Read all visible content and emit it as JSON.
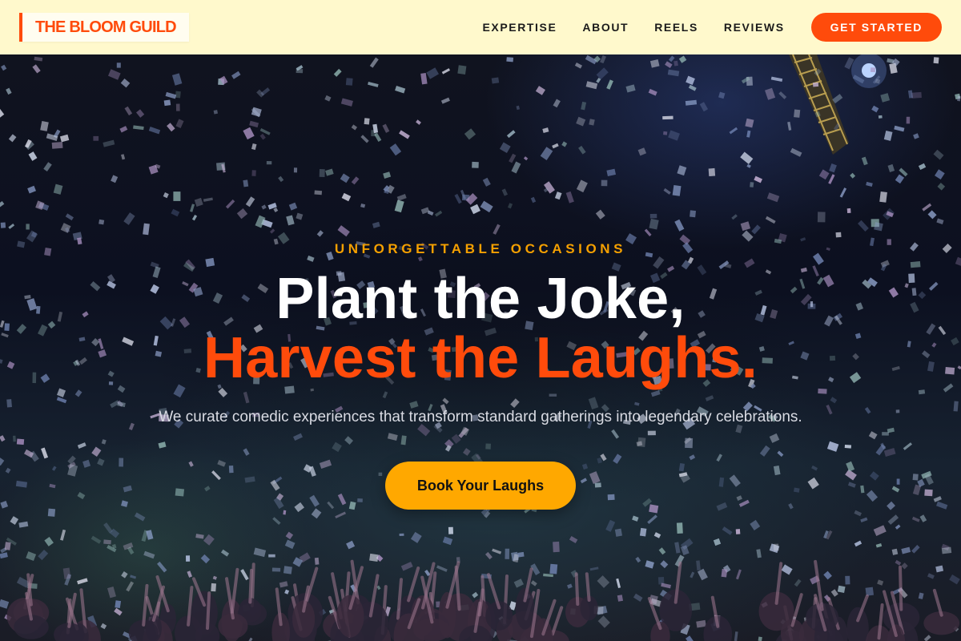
{
  "header": {
    "logo_text": "THE BLOOM GUILD",
    "nav": [
      {
        "label": "EXPERTISE"
      },
      {
        "label": "ABOUT"
      },
      {
        "label": "REELS"
      },
      {
        "label": "REVIEWS"
      }
    ],
    "cta_label": "GET STARTED"
  },
  "hero": {
    "eyebrow": "UNFORGETTABLE OCCASIONS",
    "headline_line1": "Plant the Joke,",
    "headline_line2": "Harvest the Laughs.",
    "subheadline": "We curate comedic experiences that transform standard gatherings into legendary celebrations.",
    "cta_label": "Book Your Laughs",
    "background_description_icon": "confetti-crowd-photo"
  },
  "colors": {
    "header_bg": "#fff9cc",
    "accent_orange": "#ff4b0b",
    "accent_amber": "#ffa800",
    "eyebrow": "#f5a000",
    "hero_text": "#ffffff"
  }
}
